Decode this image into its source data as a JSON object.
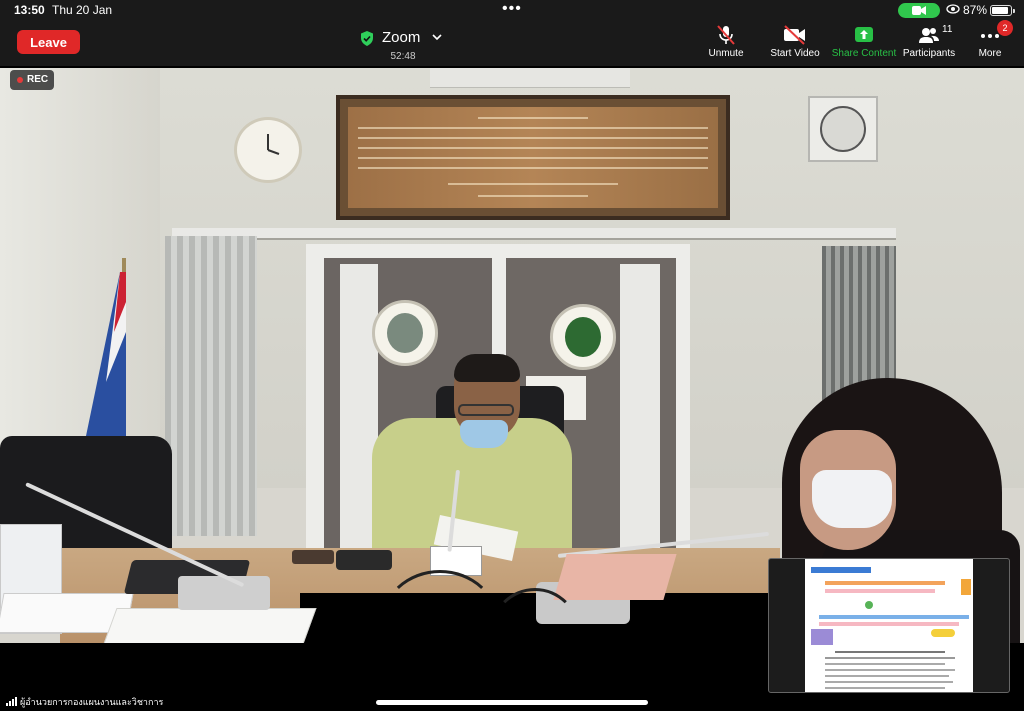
{
  "status_bar": {
    "time": "13:50",
    "date": "Thu 20 Jan",
    "battery_percent": "87%",
    "battery_level": 0.87
  },
  "toolbar": {
    "leave_label": "Leave",
    "meeting_name": "Zoom",
    "timer": "52:48",
    "unmute_label": "Unmute",
    "start_video_label": "Start Video",
    "share_label": "Share Content",
    "participants_label": "Participants",
    "participants_count": "11",
    "more_label": "More",
    "more_badge": "2"
  },
  "recording": {
    "label": "REC"
  },
  "active_speaker": {
    "name": "ผู้อำนวยการกองแผนงานและวิชาการ"
  },
  "colors": {
    "leave_red": "#e02828",
    "share_green": "#28c046",
    "call_pill_green": "#30c74d",
    "toolbar_bg": "#1a1a1a"
  },
  "icons": {
    "meeting": "shield-check-icon",
    "unmute": "microphone-muted-icon",
    "start_video": "video-camera-off-icon",
    "share": "share-arrow-up-icon",
    "participants": "people-icon",
    "more": "ellipsis-icon"
  }
}
